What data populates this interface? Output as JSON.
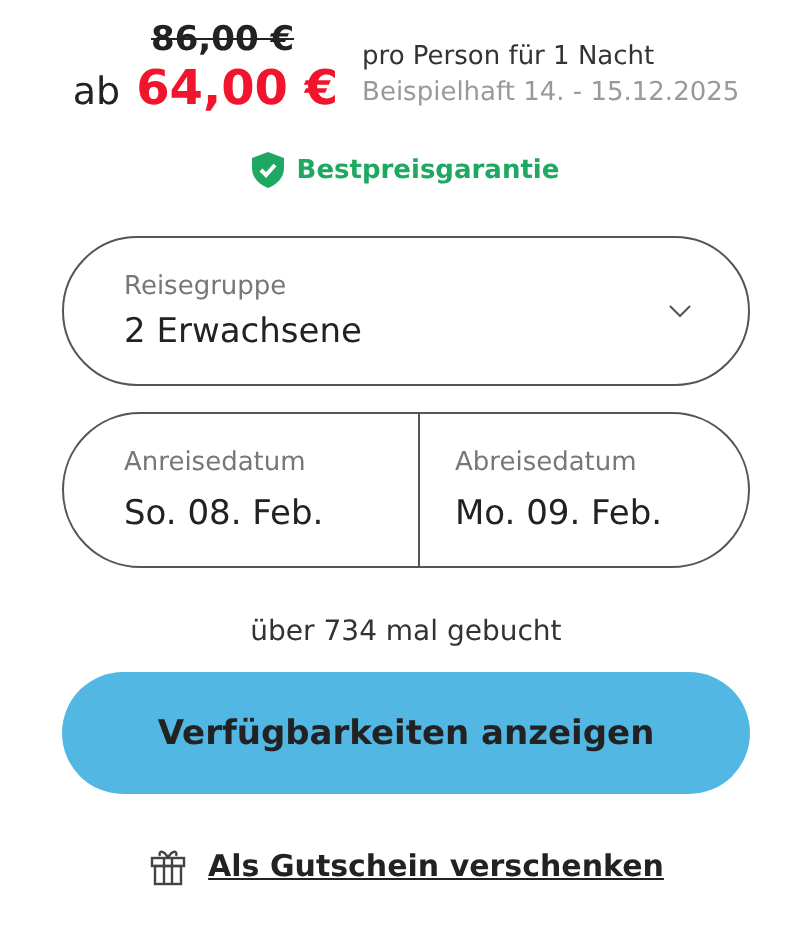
{
  "price": {
    "old": "86,00 €",
    "prefix": "ab",
    "current": "64,00 €",
    "unit": "pro Person für 1 Nacht",
    "example": "Beispielhaft 14. - 15.12.2025"
  },
  "guarantee": {
    "label": "Bestpreisgarantie"
  },
  "travel_group": {
    "label": "Reisegruppe",
    "value": "2 Erwachsene"
  },
  "dates": [
    {
      "label": "Anreisedatum",
      "value": "So. 08. Feb."
    },
    {
      "label": "Abreisedatum",
      "value": "Mo. 09. Feb."
    }
  ],
  "bookings": "über 734 mal gebucht",
  "primary_button": "Verfügbarkeiten anzeigen",
  "gift_link": "Als Gutschein verschenken"
}
